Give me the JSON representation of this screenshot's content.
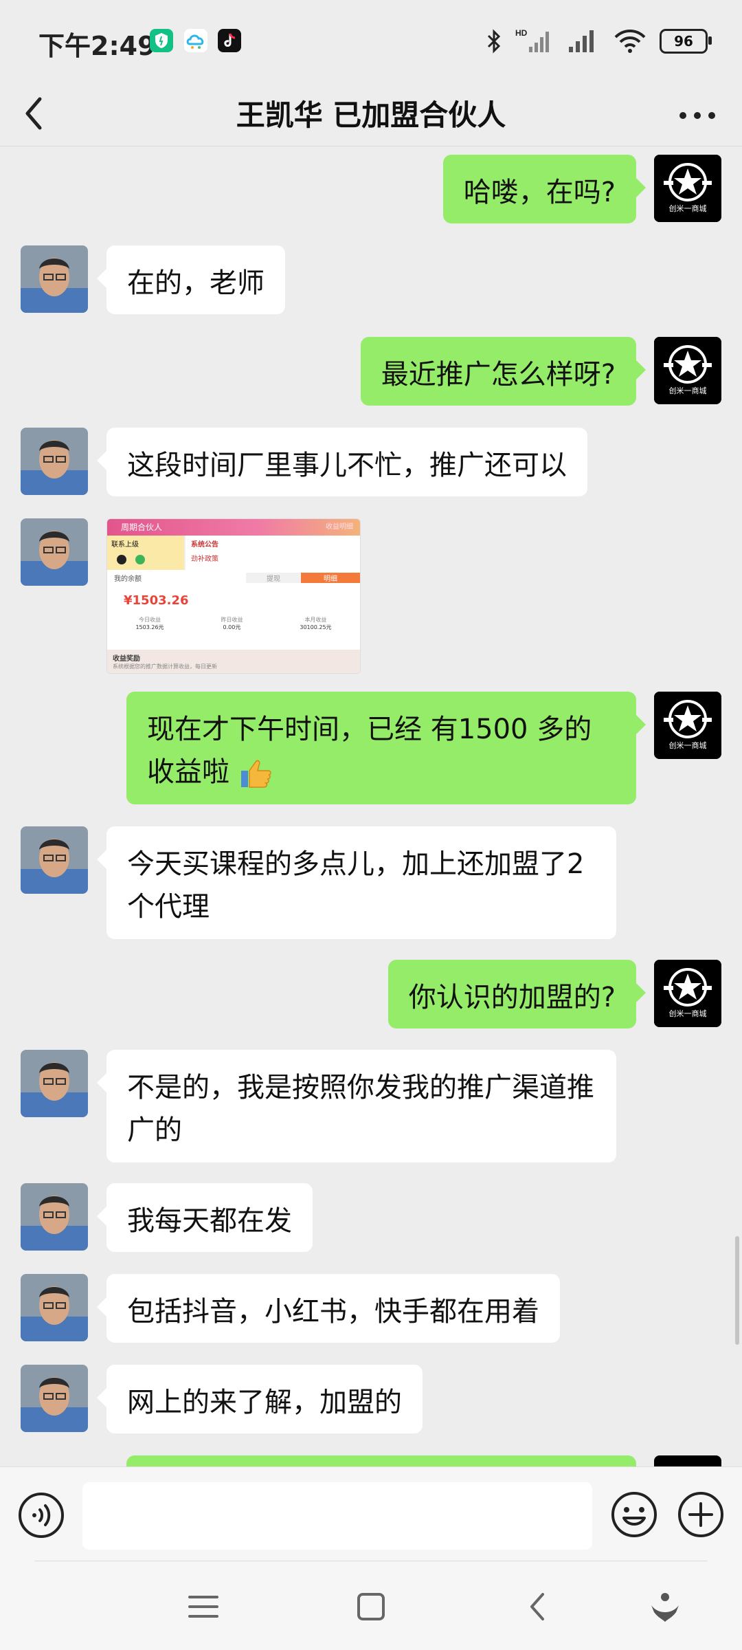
{
  "status_bar": {
    "time": "下午2:49",
    "battery": "96",
    "icons": [
      "shield-app-icon",
      "cloud-app-icon",
      "tiktok-app-icon",
      "bluetooth-icon",
      "signal-hd-icon",
      "signal-icon",
      "wifi-icon",
      "battery-icon"
    ]
  },
  "header": {
    "title": "王凯华 已加盟合伙人",
    "back_icon": "chevron-left-icon",
    "more_icon": "more-dots-icon"
  },
  "own_avatar_label": "创米一商城",
  "messages": [
    {
      "side": "out",
      "text": "哈喽，在吗?"
    },
    {
      "side": "in",
      "text": "在的，老师"
    },
    {
      "side": "out",
      "text": "最近推广怎么样呀?"
    },
    {
      "side": "in",
      "text": "这段时间厂里事儿不忙，推广还可以"
    },
    {
      "side": "in",
      "type": "image"
    },
    {
      "side": "out",
      "text": "现在才下午时间，已经 有1500 多的收益啦",
      "emoji": "thumbs-up-icon"
    },
    {
      "side": "in",
      "text": "今天买课程的多点儿，加上还加盟了2个代理"
    },
    {
      "side": "out",
      "text": "你认识的加盟的?"
    },
    {
      "side": "in",
      "text": "不是的，我是按照你发我的推广渠道推广的"
    },
    {
      "side": "in",
      "text": "我每天都在发"
    },
    {
      "side": "in",
      "text": "包括抖音，小红书，快手都在用着"
    },
    {
      "side": "in",
      "text": "网上的来了解，加盟的"
    }
  ],
  "image_message": {
    "title": "周期合伙人",
    "top_right": "收益明细",
    "left_tab": "联系上级",
    "right_tab": "系统公告",
    "notice": "劲补政策",
    "balance_label": "我的余额",
    "tab_withdraw": "提现",
    "tab_detail": "明细",
    "balance": "¥1503.26",
    "stats": [
      {
        "label": "今日收益",
        "value": "1503.26元"
      },
      {
        "label": "昨日收益",
        "value": "0.00元"
      },
      {
        "label": "本月收益",
        "value": "30100.25元"
      }
    ],
    "footer_title": "收益奖励",
    "footer_text": "系统根据您的推广数据计算收益，每日更新"
  },
  "input_bar": {
    "voice_icon": "voice-icon",
    "input_value": "",
    "emoji_icon": "emoji-icon",
    "plus_icon": "plus-icon"
  },
  "system_nav": [
    "menu-icon",
    "home-icon",
    "back-icon",
    "assistant-icon"
  ]
}
